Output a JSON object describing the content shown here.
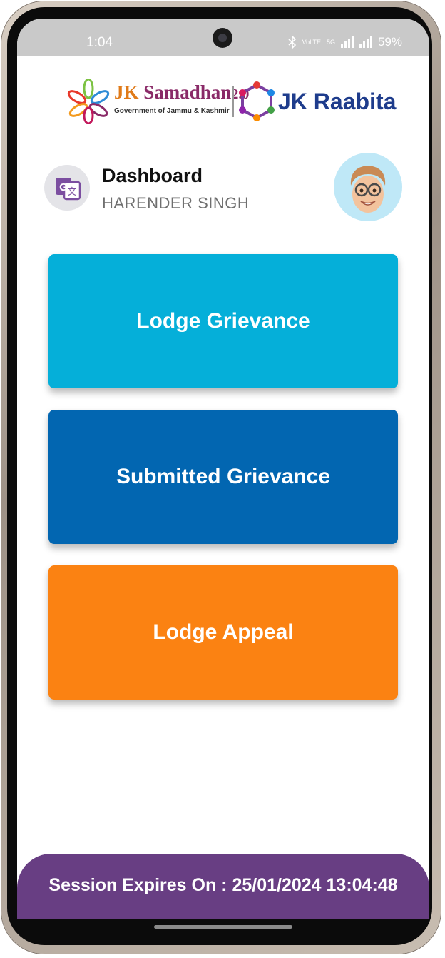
{
  "status_bar": {
    "time": "1:04",
    "bluetooth_icon": "bluetooth-icon",
    "volte_label": "VoLTE",
    "network_label": "5G",
    "battery": "59%"
  },
  "header": {
    "samadhan_jk": "JK",
    "samadhan_name": " Samadhan",
    "samadhan_version": "2.0",
    "samadhan_subtitle": "Government of Jammu & Kashmir",
    "raabita": "JK Raabita"
  },
  "dashboard": {
    "title": "Dashboard",
    "user_name": "HARENDER SINGH"
  },
  "actions": [
    {
      "label": "Lodge Grievance",
      "color": "#05afd9"
    },
    {
      "label": "Submitted Grievance",
      "color": "#0266b1"
    },
    {
      "label": "Lodge Appeal",
      "color": "#fb8212"
    }
  ],
  "session": {
    "text": "Session Expires On : 25/01/2024 13:04:48",
    "color": "#683e83"
  }
}
